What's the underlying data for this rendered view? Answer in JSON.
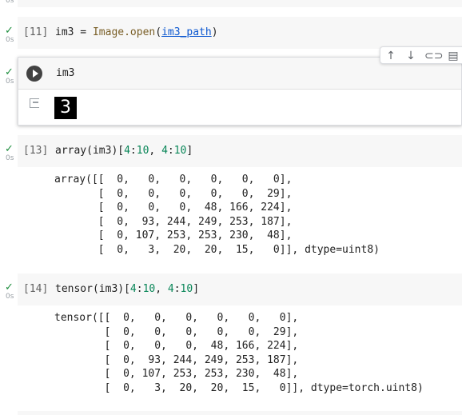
{
  "cells": [
    {
      "count": "[11]",
      "time": "0s",
      "code": {
        "var": "im3",
        "op": " = ",
        "fn": "Image.open",
        "paren_open": "(",
        "arg": "im3_path",
        "paren_close": ")"
      }
    },
    {
      "count": "",
      "time": "0s",
      "code_text": "im3",
      "output_image_text": "3"
    },
    {
      "count": "[13]",
      "time": "0s",
      "code": {
        "prefix": "array(im3)[",
        "a": "4",
        "colon1": ":",
        "b": "10",
        "sep": ", ",
        "c": "4",
        "colon2": ":",
        "d": "10",
        "suffix": "]"
      },
      "output": "array([[  0,   0,   0,   0,   0,   0],\n       [  0,   0,   0,   0,   0,  29],\n       [  0,   0,   0,  48, 166, 224],\n       [  0,  93, 244, 249, 253, 187],\n       [  0, 107, 253, 253, 230,  48],\n       [  0,   3,  20,  20,  15,   0]], dtype=uint8)"
    },
    {
      "count": "[14]",
      "time": "0s",
      "code": {
        "prefix": "tensor(im3)[",
        "a": "4",
        "colon1": ":",
        "b": "10",
        "sep": ", ",
        "c": "4",
        "colon2": ":",
        "d": "10",
        "suffix": "]"
      },
      "output": "tensor([[  0,   0,   0,   0,   0,   0],\n        [  0,   0,   0,   0,   0,  29],\n        [  0,   0,   0,  48, 166, 224],\n        [  0,  93, 244, 249, 253, 187],\n        [  0, 107, 253, 253, 230,  48],\n        [  0,   3,  20,  20,  15,   0]], dtype=torch.uint8)"
    }
  ],
  "toolbar": {
    "icons": [
      "arrow-up-icon",
      "arrow-down-icon",
      "link-icon",
      "comment-icon"
    ]
  },
  "colors": {
    "check": "#1e8e3e",
    "number": "#098658",
    "link": "#0b57d0",
    "cell_bg": "#f7f7f7"
  }
}
